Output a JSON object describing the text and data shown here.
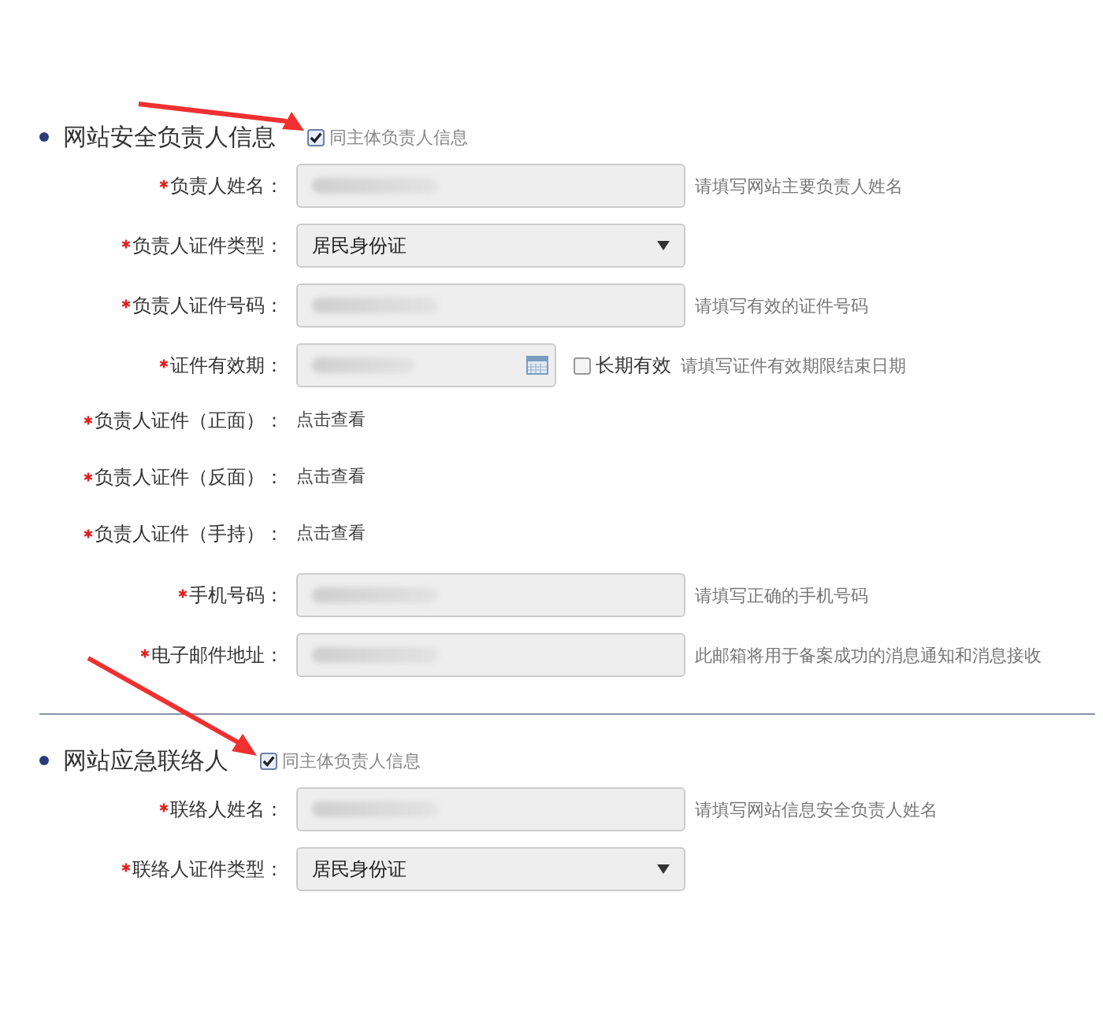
{
  "sections": [
    {
      "title": "网站安全负责人信息",
      "same_as_owner": {
        "label": "同主体负责人信息",
        "checked": true
      },
      "fields": [
        {
          "kind": "input",
          "label": "负责人姓名：",
          "required": true,
          "hint": "请填写网站主要负责人姓名"
        },
        {
          "kind": "select",
          "label": "负责人证件类型：",
          "required": true,
          "value": "居民身份证"
        },
        {
          "kind": "input",
          "label": "负责人证件号码：",
          "required": true,
          "hint": "请填写有效的证件号码"
        },
        {
          "kind": "date",
          "label": "证件有效期：",
          "required": true,
          "option": {
            "label": "长期有效",
            "checked": false
          },
          "hint": "请填写证件有效期限结束日期"
        },
        {
          "kind": "link",
          "label": "负责人证件（正面）：",
          "required": true,
          "link": "点击查看"
        },
        {
          "kind": "link",
          "label": "负责人证件（反面）：",
          "required": true,
          "link": "点击查看"
        },
        {
          "kind": "link",
          "label": "负责人证件（手持）：",
          "required": true,
          "link": "点击查看"
        },
        {
          "kind": "input",
          "label": "手机号码：",
          "required": true,
          "hint": "请填写正确的手机号码"
        },
        {
          "kind": "input",
          "label": "电子邮件地址：",
          "required": true,
          "hint": "此邮箱将用于备案成功的消息通知和消息接收"
        }
      ]
    },
    {
      "title": "网站应急联络人",
      "same_as_owner": {
        "label": "同主体负责人信息",
        "checked": true
      },
      "fields": [
        {
          "kind": "input",
          "label": "联络人姓名：",
          "required": true,
          "hint": "请填写网站信息安全负责人姓名"
        },
        {
          "kind": "select",
          "label": "联络人证件类型：",
          "required": true,
          "value": "居民身份证"
        }
      ]
    }
  ]
}
